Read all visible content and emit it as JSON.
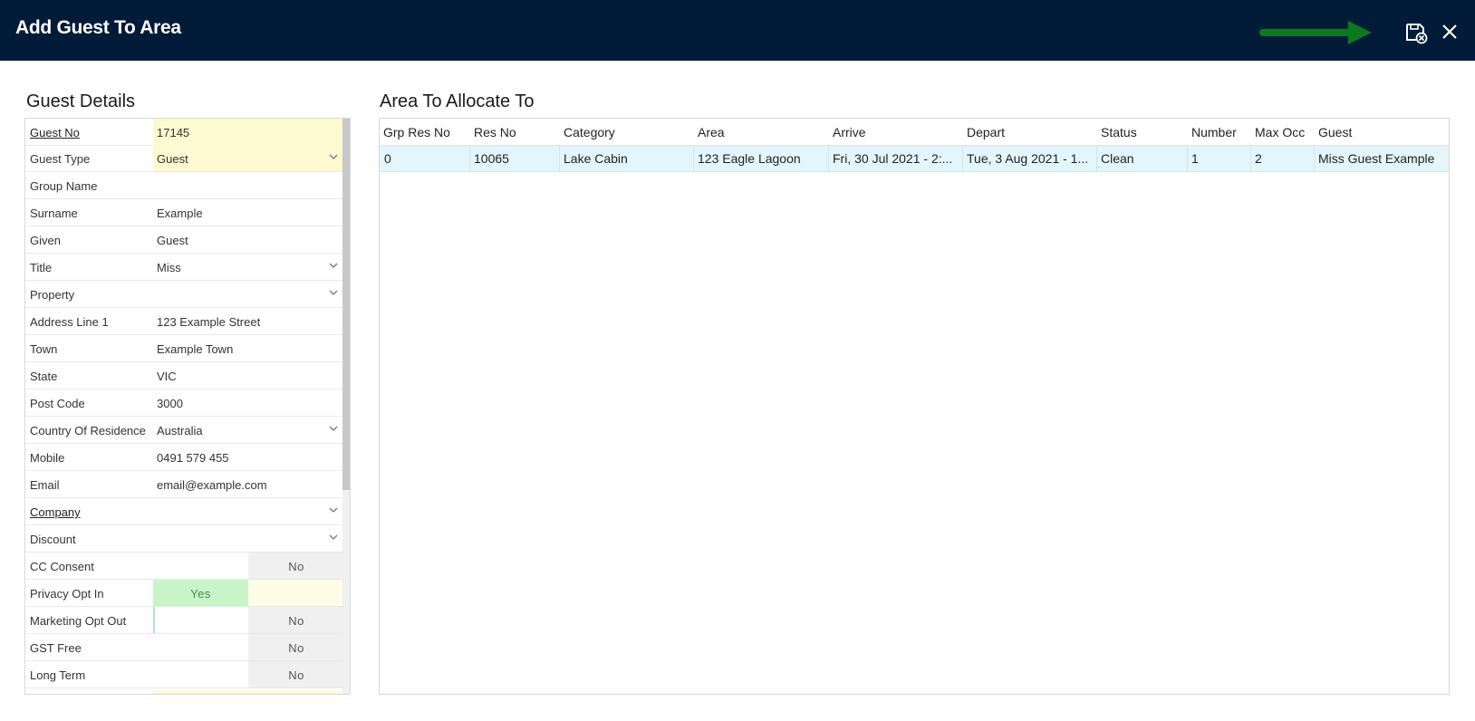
{
  "window": {
    "title": "Add Guest To Area"
  },
  "colors": {
    "titlebar": "#011b38",
    "arrow": "#0a7a1f",
    "row_highlight": "#e2f6fb",
    "yes_on": "#c8f5c8",
    "required": "#fdf9d1"
  },
  "guest_details": {
    "title": "Guest Details",
    "fields": [
      {
        "label": "Guest No",
        "value": "17145"
      },
      {
        "label": "Guest Type",
        "value": "Guest"
      },
      {
        "label": "Group Name",
        "value": ""
      },
      {
        "label": "Surname",
        "value": "Example"
      },
      {
        "label": "Given",
        "value": "Guest"
      },
      {
        "label": "Title",
        "value": "Miss"
      },
      {
        "label": "Property",
        "value": ""
      },
      {
        "label": "Address Line 1",
        "value": "123 Example Street"
      },
      {
        "label": "Town",
        "value": "Example Town"
      },
      {
        "label": "State",
        "value": "VIC"
      },
      {
        "label": "Post Code",
        "value": "3000"
      },
      {
        "label": "Country Of Residence",
        "value": "Australia"
      },
      {
        "label": "Mobile",
        "value": "0491 579 455"
      },
      {
        "label": "Email",
        "value": "email@example.com"
      },
      {
        "label": "Company",
        "value": ""
      },
      {
        "label": "Discount",
        "value": ""
      }
    ],
    "toggles": [
      {
        "label": "CC Consent",
        "yes": "",
        "no": "No"
      },
      {
        "label": "Privacy Opt In",
        "yes": "Yes",
        "no": ""
      },
      {
        "label": "Marketing Opt Out",
        "yes": "",
        "no": "No"
      },
      {
        "label": "GST Free",
        "yes": "",
        "no": "No"
      },
      {
        "label": "Long Term",
        "yes": "",
        "no": "No"
      }
    ]
  },
  "area_table": {
    "title": "Area To Allocate To",
    "headers": [
      "Grp Res No",
      "Res No",
      "Category",
      "Area",
      "Arrive",
      "Depart",
      "Status",
      "Number",
      "Max Occ",
      "Guest"
    ],
    "rows": [
      [
        "0",
        "10065",
        "Lake Cabin",
        "123 Eagle Lagoon",
        "Fri, 30 Jul 2021 - 2:...",
        "Tue, 3 Aug 2021 - 1...",
        "Clean",
        "1",
        "2",
        "Miss Guest Example"
      ]
    ]
  }
}
